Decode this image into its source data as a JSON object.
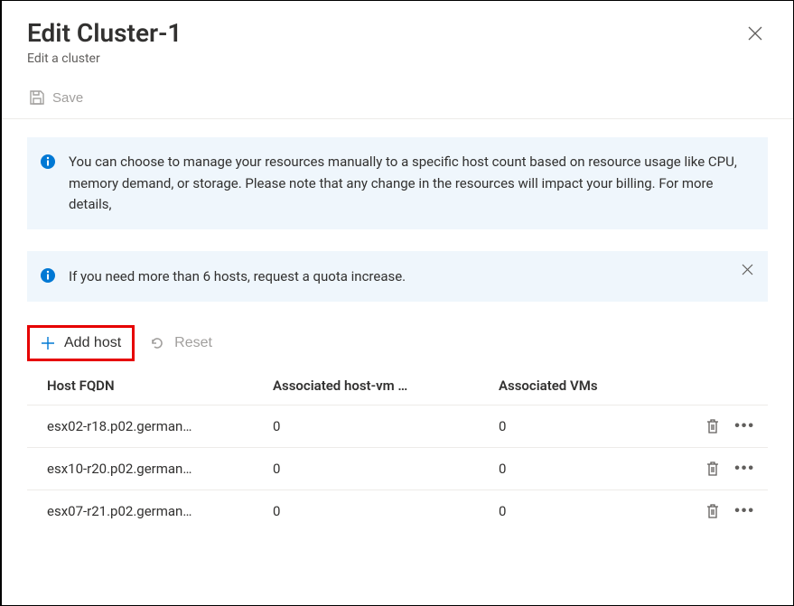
{
  "header": {
    "title": "Edit Cluster-1",
    "subtitle": "Edit a cluster"
  },
  "toolbar": {
    "save_label": "Save"
  },
  "banners": {
    "info1": "You can choose to manage your resources manually to a specific host count based on resource usage like CPU, memory demand, or storage. Please note that any change in the resources will impact your billing. For more details,",
    "info2": "If you need more than 6 hosts, request a quota increase."
  },
  "commands": {
    "add_host_label": "Add host",
    "reset_label": "Reset"
  },
  "table": {
    "columns": {
      "fqdn": "Host FQDN",
      "host_vm": "Associated host-vm …",
      "vms": "Associated VMs"
    },
    "rows": [
      {
        "fqdn": "esx02-r18.p02.german…",
        "host_vm": "0",
        "vms": "0"
      },
      {
        "fqdn": "esx10-r20.p02.german…",
        "host_vm": "0",
        "vms": "0"
      },
      {
        "fqdn": "esx07-r21.p02.german…",
        "host_vm": "0",
        "vms": "0"
      }
    ]
  },
  "colors": {
    "accent": "#0078d4",
    "info_bg": "#eff6fc",
    "disabled": "#a19f9d",
    "highlight_border": "#e60000"
  }
}
